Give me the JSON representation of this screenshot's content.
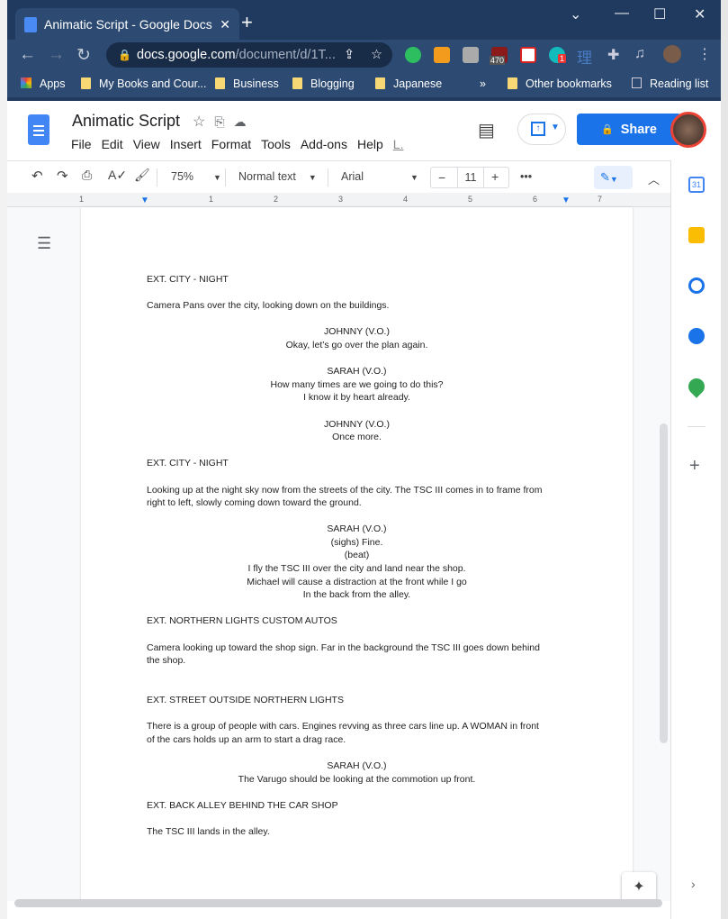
{
  "browser": {
    "tab_title": "Animatic Script - Google Docs",
    "url_host": "docs.google.com",
    "url_path": "/document/d/1T...",
    "ext_badges": [
      "470",
      "1"
    ],
    "ext_glyph": "理"
  },
  "bookmarks": [
    "Apps",
    "My Books and Cour...",
    "Business",
    "Blogging",
    "Japanese",
    "»",
    "Other bookmarks",
    "Reading list"
  ],
  "doc": {
    "title": "Animatic Script",
    "menu": [
      "File",
      "Edit",
      "View",
      "Insert",
      "Format",
      "Tools",
      "Add-ons",
      "Help",
      "L."
    ],
    "share_label": "Share"
  },
  "toolbar": {
    "zoom": "75%",
    "style": "Normal text",
    "font": "Arial",
    "size": "11",
    "more": "•••"
  },
  "ruler": [
    "1",
    "1",
    "2",
    "3",
    "4",
    "5",
    "6",
    "7"
  ],
  "lines": [
    {
      "t": "EXT. CITY - NIGHT",
      "a": "l"
    },
    {
      "t": "",
      "a": "l"
    },
    {
      "t": "Camera Pans over the city, looking down on the buildings.",
      "a": "l"
    },
    {
      "t": "",
      "a": "l"
    },
    {
      "t": "JOHNNY (V.O.)",
      "a": "c"
    },
    {
      "t": "Okay, let’s go over the plan again.",
      "a": "c"
    },
    {
      "t": "",
      "a": "l"
    },
    {
      "t": "SARAH (V.O.)",
      "a": "c"
    },
    {
      "t": "How many times are we going to do this?",
      "a": "c"
    },
    {
      "t": "I know it by heart already.",
      "a": "c"
    },
    {
      "t": "",
      "a": "l"
    },
    {
      "t": "JOHNNY (V.O.)",
      "a": "c"
    },
    {
      "t": "Once more.",
      "a": "c"
    },
    {
      "t": "",
      "a": "l"
    },
    {
      "t": "EXT. CITY - NIGHT",
      "a": "l"
    },
    {
      "t": "",
      "a": "l"
    },
    {
      "t": "Looking up at the night sky now from the streets of the city. The TSC III comes in to frame from",
      "a": "l"
    },
    {
      "t": "right to left, slowly coming down toward the ground.",
      "a": "l"
    },
    {
      "t": "",
      "a": "l"
    },
    {
      "t": "SARAH (V.O.)",
      "a": "c"
    },
    {
      "t": "(sighs) Fine.",
      "a": "c"
    },
    {
      "t": "(beat)",
      "a": "c"
    },
    {
      "t": "I fly the TSC III over the city and land near the shop.",
      "a": "c"
    },
    {
      "t": "Michael will cause a distraction at the front while I go",
      "a": "c"
    },
    {
      "t": "In the back from the alley.",
      "a": "c"
    },
    {
      "t": "",
      "a": "l"
    },
    {
      "t": "EXT. NORTHERN LIGHTS CUSTOM AUTOS",
      "a": "l"
    },
    {
      "t": "",
      "a": "l"
    },
    {
      "t": "Camera looking up toward the shop sign. Far in the background the TSC III goes down behind",
      "a": "l"
    },
    {
      "t": "the shop.",
      "a": "l"
    },
    {
      "t": "",
      "a": "l"
    },
    {
      "t": "",
      "a": "l"
    },
    {
      "t": "EXT. STREET OUTSIDE NORTHERN LIGHTS",
      "a": "l"
    },
    {
      "t": "",
      "a": "l"
    },
    {
      "t": "There is a group of people with cars. Engines revving as three cars line up. A WOMAN in front",
      "a": "l"
    },
    {
      "t": "of the cars holds up an arm to start a drag race.",
      "a": "l"
    },
    {
      "t": "",
      "a": "l"
    },
    {
      "t": "SARAH (V.O.)",
      "a": "c"
    },
    {
      "t": "The Varugo should be looking at the commotion up front.",
      "a": "c"
    },
    {
      "t": "",
      "a": "l"
    },
    {
      "t": "EXT. BACK ALLEY BEHIND THE CAR SHOP",
      "a": "l"
    },
    {
      "t": "",
      "a": "l"
    },
    {
      "t": "The TSC III lands in the alley.",
      "a": "l"
    }
  ]
}
